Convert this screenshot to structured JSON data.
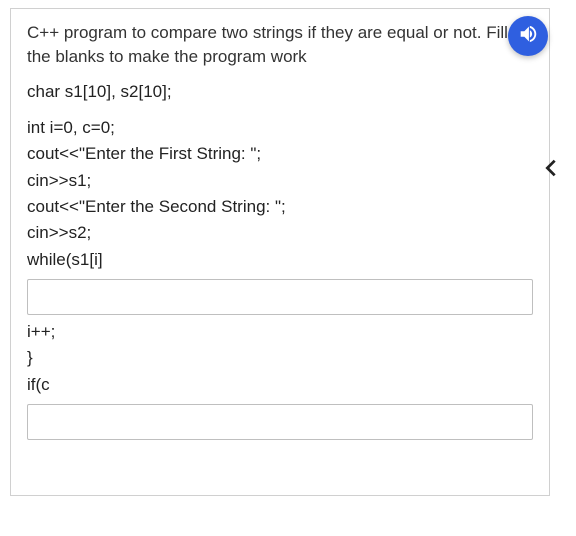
{
  "icons": {
    "audio": "speaker-icon",
    "back": "chevron-left-icon"
  },
  "card": {
    "prompt": "C++ program to compare two strings if they are equal or not. Fill in the blanks to make the program work",
    "lines": {
      "l1": "char s1[10], s2[10];",
      "l2": "int i=0, c=0;",
      "l3": "cout<<\"Enter the First String: \";",
      "l4": "cin>>s1;",
      "l5": "cout<<\"Enter the Second String: \";",
      "l6": "cin>>s2;",
      "l7": "while(s1[i]",
      "l8": "i++;",
      "l9": "}",
      "l10": "if(c"
    },
    "blanks": {
      "b1": {
        "value": "",
        "placeholder": ""
      },
      "b2": {
        "value": "",
        "placeholder": ""
      }
    }
  }
}
